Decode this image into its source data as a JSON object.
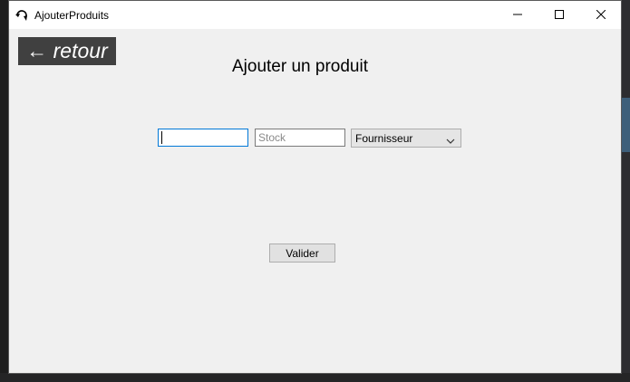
{
  "window": {
    "title": "AjouterProduits"
  },
  "nav": {
    "back_label": "← retour"
  },
  "form": {
    "heading": "Ajouter un produit",
    "name_value": "",
    "stock_placeholder": "Stock",
    "supplier_selected": "Fournisseur",
    "submit_label": "Valider"
  },
  "colors": {
    "window_bg": "#f0f0f0",
    "back_button_bg": "#404040",
    "focus_border": "#0078d7"
  },
  "icons": [
    "app-icon",
    "minimize-icon",
    "maximize-icon",
    "close-icon",
    "chevron-down-icon"
  ]
}
